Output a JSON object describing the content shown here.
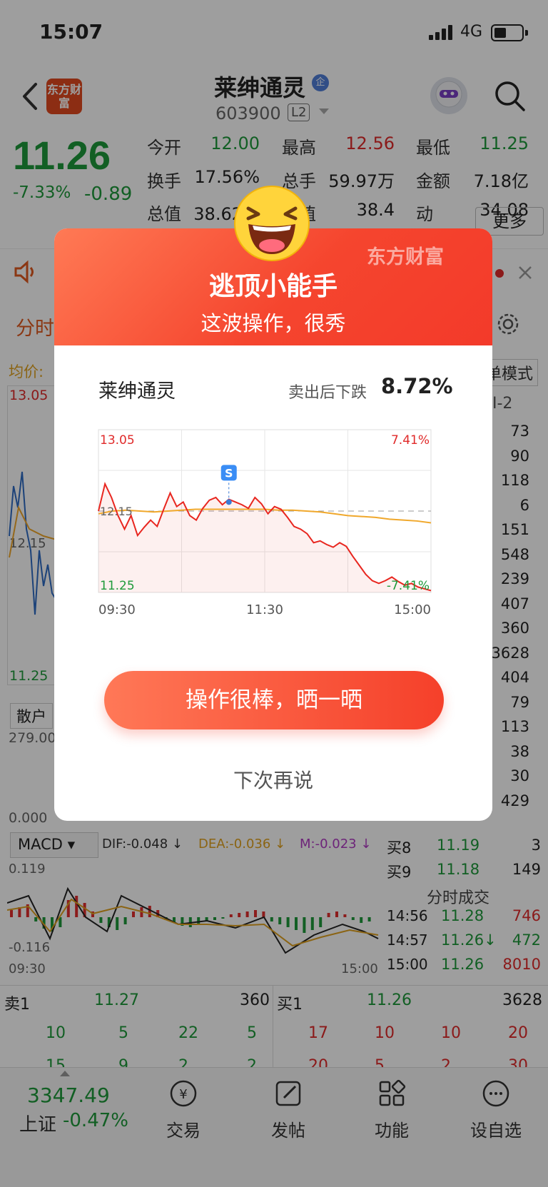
{
  "status": {
    "time": "15:07",
    "network": "4G"
  },
  "header": {
    "logo_text": "东方财富",
    "stock_name": "莱绅通灵",
    "badge": "企",
    "stock_code": "603900",
    "level": "L2"
  },
  "quote": {
    "price": "11.26",
    "change_pct": "-7.33%",
    "change": "-0.89",
    "rows": [
      [
        {
          "label": "今开",
          "value": "12.00",
          "color": "g"
        },
        {
          "label": "最高",
          "value": "12.56",
          "color": "r"
        },
        {
          "label": "最低",
          "value": "11.25",
          "color": "g"
        }
      ],
      [
        {
          "label": "换手",
          "value": "17.56%",
          "color": "k"
        },
        {
          "label": "总手",
          "value": "59.97万",
          "color": "k"
        },
        {
          "label": "金额",
          "value": "7.18亿",
          "color": "k"
        }
      ],
      [
        {
          "label": "总值",
          "value": "38.62亿",
          "color": "k"
        },
        {
          "label": "流值",
          "value": "38.4",
          "color": "k"
        },
        {
          "label": "动",
          "value": "34.08",
          "color": "k"
        }
      ]
    ],
    "more_label": "更多"
  },
  "background": {
    "tab_label": "分时",
    "avg_label": "均价:",
    "chart_high": "13.05",
    "chart_mid": "12.15",
    "chart_low": "11.25",
    "retail_label": "散户",
    "volume_label": "279.00",
    "volume_zero": "0.000",
    "mode_label": "单模式",
    "level_tab": "I-2",
    "side_values": [
      "73",
      "90",
      "118",
      "6",
      "151",
      "548",
      "239",
      "407",
      "360",
      "3628",
      "404",
      "79",
      "113",
      "38",
      "30",
      "429"
    ],
    "bids": [
      {
        "label": "买8",
        "price": "11.19",
        "vol": "3"
      },
      {
        "label": "买9",
        "price": "11.18",
        "vol": "149"
      }
    ],
    "macd": {
      "name": "MACD",
      "dif": "DIF:-0.048 ↓",
      "dea": "DEA:-0.036 ↓",
      "m": "M:-0.023 ↓",
      "top": "0.119",
      "bottom": "-0.116",
      "start": "09:30",
      "end": "15:00"
    },
    "ticks_title": "分时成交",
    "ticks": [
      {
        "time": "14:56",
        "price": "11.28",
        "vol": "746"
      },
      {
        "time": "14:57",
        "price": "11.26↓",
        "vol": "472"
      },
      {
        "time": "15:00",
        "price": "11.26",
        "vol": "8010"
      }
    ],
    "book": {
      "sell1": {
        "label": "卖1",
        "price": "11.27",
        "vol": "360"
      },
      "buy1": {
        "label": "买1",
        "price": "11.26",
        "vol": "3628"
      },
      "sell_row1": [
        "10",
        "5",
        "22",
        "5"
      ],
      "buy_row1": [
        "17",
        "10",
        "10",
        "20"
      ],
      "sell_row2": [
        "15",
        "9",
        "2",
        "2"
      ],
      "buy_row2": [
        "20",
        "5",
        "2",
        "30"
      ]
    }
  },
  "bottom_nav": {
    "index_price": "3347.49",
    "index_name": "上证",
    "index_pct": "-0.47%",
    "items": [
      "交易",
      "发帖",
      "功能",
      "设自选"
    ]
  },
  "modal": {
    "title": "逃顶小能手",
    "subtitle": "这波操作，很秀",
    "watermark": "东方财富",
    "stock_name": "莱绅通灵",
    "drop_label": "卖出后下跌",
    "drop_value": "8.72%",
    "share_button": "操作很棒，晒一晒",
    "later_button": "下次再说",
    "sell_marker": "S"
  },
  "chart_data": {
    "type": "line",
    "x_labels": [
      "09:30",
      "11:30",
      "15:00"
    ],
    "ylim": [
      11.25,
      13.05
    ],
    "y_labels": {
      "top": "13.05",
      "mid": "12.15",
      "bottom": "11.25"
    },
    "pct_labels": {
      "top": "7.41%",
      "bottom": "-7.41%"
    },
    "series": [
      {
        "color": "#e8261f",
        "values": [
          12.15,
          12.45,
          12.3,
          12.1,
          11.95,
          12.1,
          11.88,
          11.97,
          12.05,
          11.98,
          12.17,
          12.35,
          12.2,
          12.25,
          12.1,
          12.05,
          12.18,
          12.27,
          12.3,
          12.22,
          12.28,
          12.25,
          12.22,
          12.18,
          12.3,
          12.23,
          12.12,
          12.2,
          12.17,
          12.08,
          11.98,
          11.95,
          11.9,
          11.8,
          11.82,
          11.78,
          11.75,
          11.8,
          11.76,
          11.65,
          11.55,
          11.45,
          11.38,
          11.35,
          11.38,
          11.42,
          11.37,
          11.33,
          11.35,
          11.31,
          11.29,
          11.27
        ]
      },
      {
        "color": "#f0a82c",
        "values": [
          12.12,
          12.15,
          12.16,
          12.15,
          12.14,
          12.15,
          12.16,
          12.17,
          12.17,
          12.17,
          12.17,
          12.17,
          12.17,
          12.16,
          12.16,
          12.15,
          12.14,
          12.12,
          12.1,
          12.09,
          12.08,
          12.06,
          12.05,
          12.04,
          12.02
        ]
      }
    ],
    "baseline": 12.15,
    "sell_point": {
      "index": 20,
      "value": 12.25
    }
  }
}
